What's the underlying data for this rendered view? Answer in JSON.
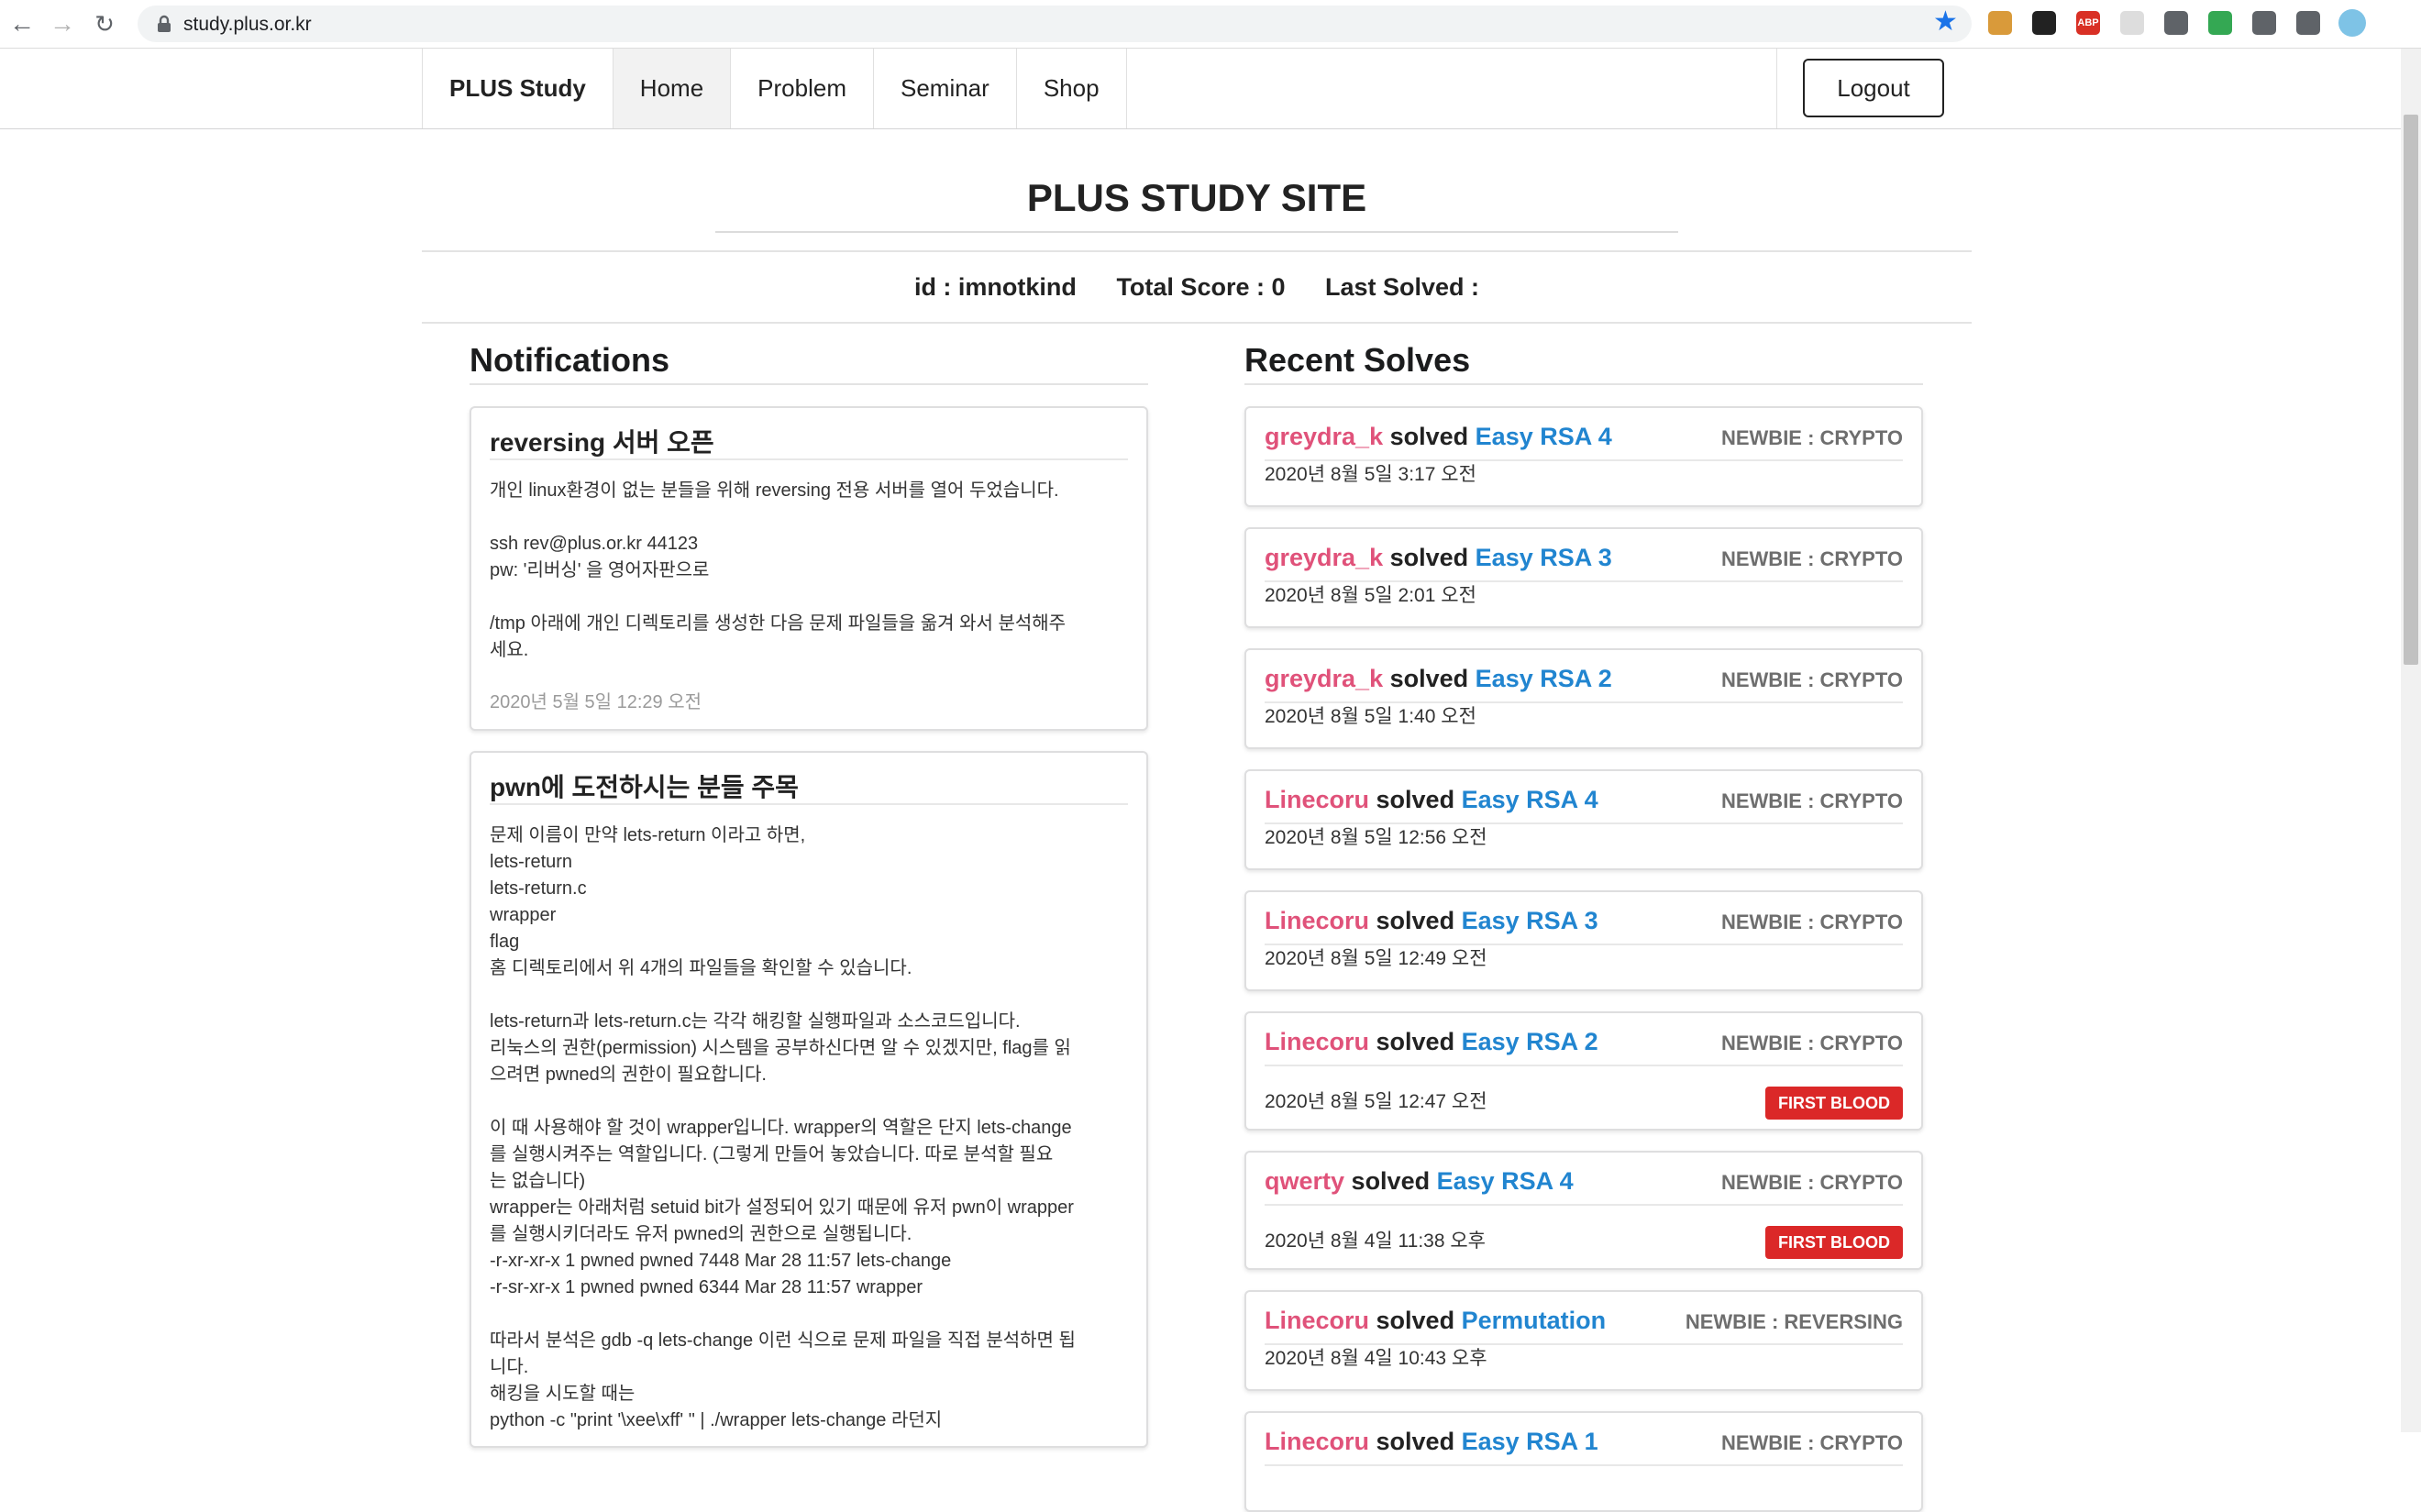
{
  "browser": {
    "url": "study.plus.or.kr",
    "extensions": [
      {
        "name": "cookie-ext-icon",
        "color": "#d99a3a"
      },
      {
        "name": "glasses-ext-icon",
        "color": "#222222"
      },
      {
        "name": "adblock-ext-icon",
        "label": "ABP",
        "color": "#d93025"
      },
      {
        "name": "blank-ext-icon",
        "color": "#dddddd"
      },
      {
        "name": "v-ext-icon",
        "color": "#5f6368"
      },
      {
        "name": "shield-ext-icon",
        "color": "#34a853"
      },
      {
        "name": "puzzle-ext-icon",
        "color": "#5f6368"
      },
      {
        "name": "playlist-icon",
        "color": "#5f6368"
      },
      {
        "name": "profile-avatar",
        "color": "#7ec3e6"
      }
    ]
  },
  "nav": {
    "brand": "PLUS Study",
    "items": [
      "Home",
      "Problem",
      "Seminar",
      "Shop"
    ],
    "active": "Home",
    "logout": "Logout"
  },
  "header": {
    "title": "PLUS STUDY SITE",
    "id_text": "id : imnotkind",
    "score_text": "Total Score : 0",
    "last_solved_text": "Last Solved :"
  },
  "notifications": {
    "heading": "Notifications",
    "items": [
      {
        "title": "reversing 서버 오픈",
        "lines": [
          "개인 linux환경이 없는 분들을 위해 reversing 전용 서버를 열어 두었습니다.",
          "",
          "ssh rev@plus.or.kr 44123",
          "pw: '리버싱' 을 영어자판으로",
          "",
          "/tmp 아래에 개인 디렉토리를 생성한 다음 문제 파일들을 옮겨 와서 분석해주",
          "세요."
        ],
        "date": "2020년 5월 5일 12:29 오전"
      },
      {
        "title": "pwn에 도전하시는 분들 주목",
        "lines": [
          "문제 이름이 만약 lets-return 이라고 하면,",
          "lets-return",
          "lets-return.c",
          "wrapper",
          "flag",
          "홈 디렉토리에서 위 4개의 파일들을 확인할 수 있습니다.",
          "",
          "lets-return과 lets-return.c는 각각 해킹할 실행파일과 소스코드입니다.",
          "리눅스의 권한(permission) 시스템을 공부하신다면 알 수 있겠지만, flag를 읽",
          "으려면 pwned의 권한이 필요합니다.",
          "",
          "이 때 사용해야 할 것이 wrapper입니다. wrapper의 역할은 단지 lets-change",
          "를 실행시켜주는 역할입니다. (그렇게 만들어 놓았습니다. 따로 분석할 필요",
          "는 없습니다)",
          "wrapper는 아래처럼 setuid bit가 설정되어 있기 때문에 유저 pwn이 wrapper",
          "를 실행시키더라도 유저 pwned의 권한으로 실행됩니다.",
          "-r-xr-xr-x 1 pwned pwned 7448 Mar 28 11:57 lets-change",
          "-r-sr-xr-x 1 pwned pwned 6344 Mar 28 11:57 wrapper",
          "",
          "따라서 분석은 gdb -q lets-change 이런 식으로 문제 파일을 직접 분석하면 됩",
          "니다.",
          "해킹을 시도할 때는",
          "python -c \"print '\\xee\\xff' \" | ./wrapper lets-change 라던지"
        ],
        "date": ""
      }
    ]
  },
  "recent": {
    "heading": "Recent Solves",
    "solved_word": "solved",
    "items": [
      {
        "user": "greydra_k",
        "problem": "Easy RSA 4",
        "category": "NEWBIE : CRYPTO",
        "date": "2020년 8월 5일 3:17 오전",
        "badge": ""
      },
      {
        "user": "greydra_k",
        "problem": "Easy RSA 3",
        "category": "NEWBIE : CRYPTO",
        "date": "2020년 8월 5일 2:01 오전",
        "badge": ""
      },
      {
        "user": "greydra_k",
        "problem": "Easy RSA 2",
        "category": "NEWBIE : CRYPTO",
        "date": "2020년 8월 5일 1:40 오전",
        "badge": ""
      },
      {
        "user": "Linecoru",
        "problem": "Easy RSA 4",
        "category": "NEWBIE : CRYPTO",
        "date": "2020년 8월 5일 12:56 오전",
        "badge": ""
      },
      {
        "user": "Linecoru",
        "problem": "Easy RSA 3",
        "category": "NEWBIE : CRYPTO",
        "date": "2020년 8월 5일 12:49 오전",
        "badge": ""
      },
      {
        "user": "Linecoru",
        "problem": "Easy RSA 2",
        "category": "NEWBIE : CRYPTO",
        "date": "2020년 8월 5일 12:47 오전",
        "badge": "FIRST BLOOD"
      },
      {
        "user": "qwerty",
        "problem": "Easy RSA 4",
        "category": "NEWBIE : CRYPTO",
        "date": "2020년 8월 4일 11:38 오후",
        "badge": "FIRST BLOOD"
      },
      {
        "user": "Linecoru",
        "problem": "Permutation",
        "category": "NEWBIE : REVERSING",
        "date": "2020년 8월 4일 10:43 오후",
        "badge": ""
      },
      {
        "user": "Linecoru",
        "problem": "Easy RSA 1",
        "category": "NEWBIE : CRYPTO",
        "date": "",
        "badge": ""
      }
    ]
  }
}
